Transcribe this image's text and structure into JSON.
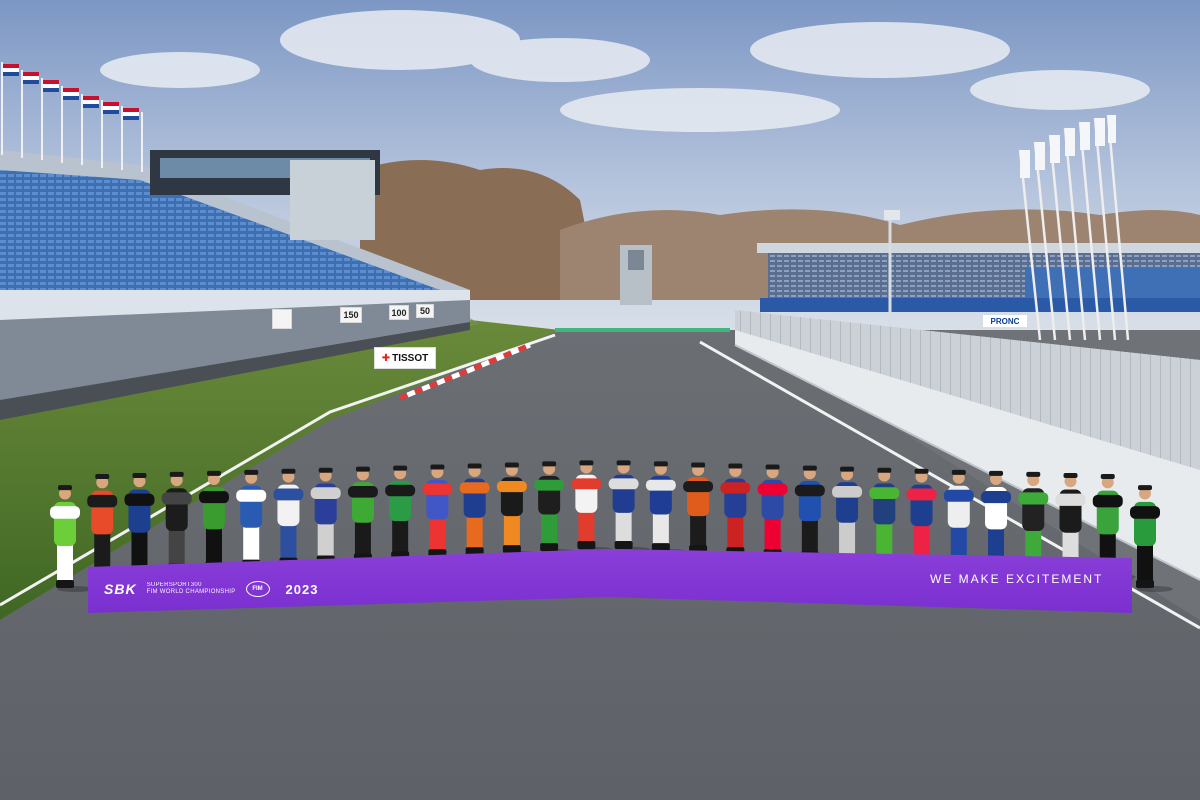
{
  "banner": {
    "logo_text": "SBK",
    "subtitle_line1": "SUPERSPORT300",
    "subtitle_line2": "FIM WORLD CHAMPIONSHIP",
    "fim_mark": "FIM",
    "year": "2023",
    "tagline": "WE MAKE EXCITEMENT",
    "color": "#7d33d3"
  },
  "trackside_signs": {
    "distance_markers": [
      "150",
      "100",
      "50"
    ],
    "sponsor": "TISSOT",
    "promo": "PRONC"
  },
  "scene": {
    "rider_count": 30,
    "sky_color": "#9fb6d8",
    "asphalt_color": "#6d7176",
    "grass_color": "#4f7a2f",
    "stand_seat_color": "#4a7fc1"
  }
}
